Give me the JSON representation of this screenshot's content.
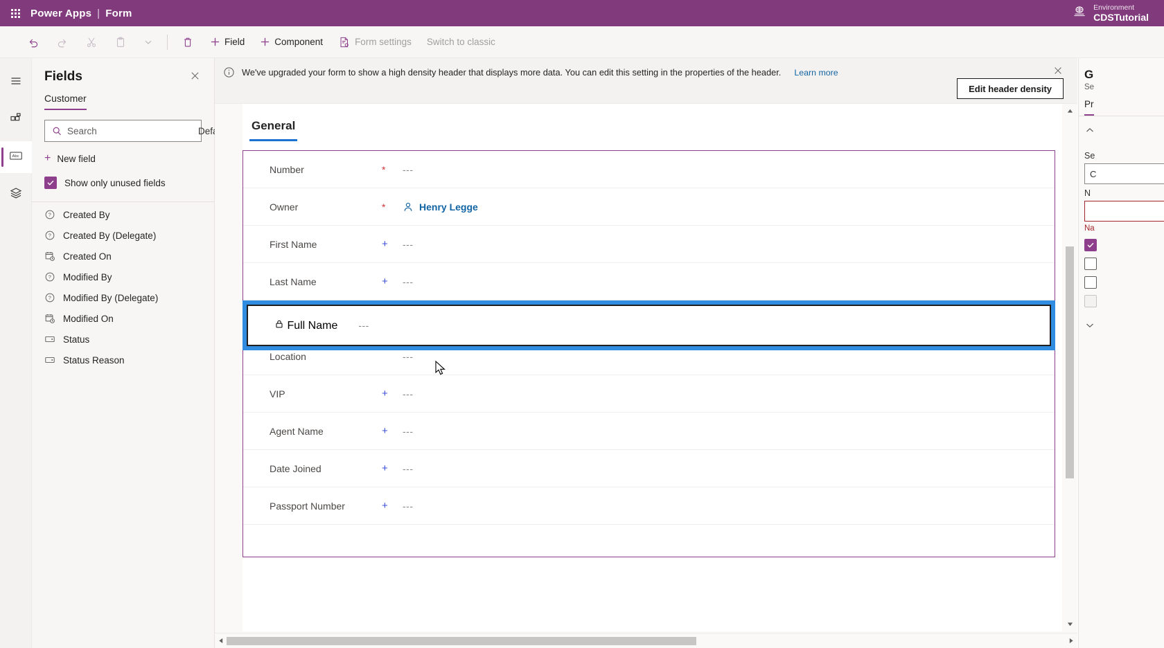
{
  "topbar": {
    "waffle_icon": "app-launcher-icon",
    "product": "Power Apps",
    "separator": "|",
    "page": "Form",
    "env_icon": "environment-globe-icon",
    "env_label": "Environment",
    "env_name": "CDSTutorial"
  },
  "commandbar": {
    "items": [
      {
        "name": "undo",
        "label": "",
        "icon": "undo-icon",
        "disabled": false,
        "icononly": true
      },
      {
        "name": "redo",
        "label": "",
        "icon": "redo-icon",
        "disabled": true,
        "icononly": true
      },
      {
        "name": "cut",
        "label": "",
        "icon": "scissors-icon",
        "disabled": true,
        "icononly": true
      },
      {
        "name": "paste",
        "label": "",
        "icon": "clipboard-icon",
        "disabled": true,
        "icononly": true
      },
      {
        "name": "paste-more",
        "label": "",
        "icon": "chevron-down-icon",
        "disabled": true,
        "icononly": true
      },
      {
        "name": "delete",
        "label": "",
        "icon": "trash-icon",
        "disabled": false,
        "icononly": true
      },
      {
        "name": "add-field",
        "label": "Field",
        "icon": "plus-icon",
        "disabled": false,
        "icononly": false
      },
      {
        "name": "add-component",
        "label": "Component",
        "icon": "plus-icon",
        "disabled": false,
        "icononly": false
      },
      {
        "name": "form-settings",
        "label": "Form settings",
        "icon": "form-settings-icon",
        "disabled": true,
        "icononly": false
      },
      {
        "name": "switch-to-classic",
        "label": "Switch to classic",
        "icon": "",
        "disabled": true,
        "icononly": false
      }
    ]
  },
  "rail": {
    "items": [
      {
        "name": "menu",
        "icon": "hamburger-icon",
        "active": false
      },
      {
        "name": "components",
        "icon": "components-icon",
        "active": false
      },
      {
        "name": "fields",
        "icon": "fields-icon",
        "active": true
      },
      {
        "name": "tree-view",
        "icon": "layers-icon",
        "active": false
      }
    ]
  },
  "fields_panel": {
    "title": "Fields",
    "close_icon": "close-icon",
    "tabs": [
      {
        "label": "Customer",
        "selected": true
      }
    ],
    "search": {
      "placeholder": "Search",
      "value": "",
      "icon": "search-icon"
    },
    "filter": {
      "value": "Default",
      "chevron": "chevron-down-icon"
    },
    "new_field": {
      "label": "New field",
      "icon": "plus-icon"
    },
    "show_unused": {
      "label": "Show only unused fields",
      "checked": true
    },
    "items": [
      {
        "label": "Created By",
        "icon": "lookup-icon"
      },
      {
        "label": "Created By (Delegate)",
        "icon": "lookup-icon"
      },
      {
        "label": "Created On",
        "icon": "datetime-icon"
      },
      {
        "label": "Modified By",
        "icon": "lookup-icon"
      },
      {
        "label": "Modified By (Delegate)",
        "icon": "lookup-icon"
      },
      {
        "label": "Modified On",
        "icon": "datetime-icon"
      },
      {
        "label": "Status",
        "icon": "optionset-icon"
      },
      {
        "label": "Status Reason",
        "icon": "optionset-icon"
      }
    ]
  },
  "notice": {
    "icon": "info-icon",
    "text": "We've upgraded your form to show a high density header that displays more data. You can edit this setting in the properties of the header.",
    "link": "Learn more",
    "close_icon": "close-icon",
    "button": "Edit header density"
  },
  "form": {
    "tabs": [
      {
        "label": "General",
        "selected": true
      }
    ],
    "rows": [
      {
        "label": "Number",
        "req": "star",
        "value": "---",
        "locked": false,
        "type": "text",
        "selected": false
      },
      {
        "label": "Owner",
        "req": "star",
        "value": "Henry Legge",
        "locked": false,
        "type": "person",
        "person_icon": "person-icon",
        "selected": false
      },
      {
        "label": "First Name",
        "req": "plus",
        "value": "---",
        "locked": false,
        "type": "text",
        "selected": false
      },
      {
        "label": "Last Name",
        "req": "plus",
        "value": "---",
        "locked": false,
        "type": "text",
        "selected": false
      },
      {
        "label": "Full Name",
        "req": "none",
        "value": "---",
        "locked": true,
        "type": "text",
        "selected": true,
        "lock_icon": "lock-icon"
      },
      {
        "label": "Location",
        "req": "none",
        "value": "---",
        "locked": false,
        "type": "text",
        "selected": false
      },
      {
        "label": "VIP",
        "req": "plus",
        "value": "---",
        "locked": false,
        "type": "text",
        "selected": false
      },
      {
        "label": "Agent Name",
        "req": "plus",
        "value": "---",
        "locked": false,
        "type": "text",
        "selected": false
      },
      {
        "label": "Date Joined",
        "req": "plus",
        "value": "---",
        "locked": false,
        "type": "text",
        "selected": false
      },
      {
        "label": "Passport Number",
        "req": "plus",
        "value": "---",
        "locked": false,
        "type": "text",
        "selected": false
      }
    ]
  },
  "properties_panel": {
    "title": "G",
    "subtitle": "Se",
    "tab": "Pr",
    "collapse_icon": "chevron-up-icon",
    "label_1": "Se",
    "input_1": "C",
    "label_2": "N",
    "input_2": "",
    "error": "Na",
    "checkbox_1_checked": true,
    "expand_icon": "chevron-down-icon"
  },
  "colors": {
    "brand_purple": "#813a7c",
    "accent_purple": "#8e3f8c",
    "selection_blue": "#2f8ce0",
    "tab_underline_blue": "#1a73d1",
    "link_blue": "#1264a3",
    "required_red": "#d13438",
    "optional_blue": "#3b4fd8"
  }
}
